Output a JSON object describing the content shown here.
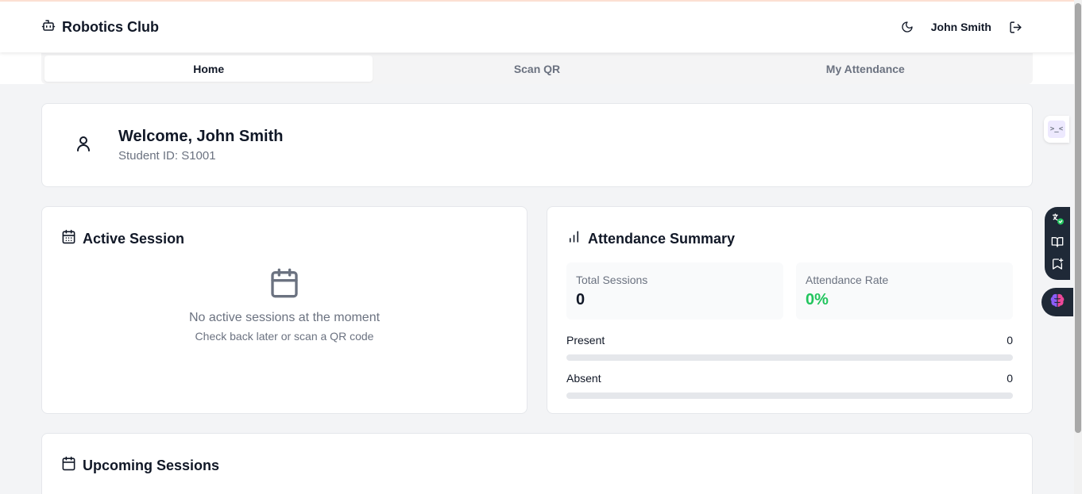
{
  "app": {
    "title": "Robotics Club"
  },
  "header": {
    "user_name": "John Smith",
    "icons": [
      "bot-icon",
      "moon-icon",
      "logout-icon"
    ]
  },
  "tabs": [
    {
      "label": "Home",
      "active": true
    },
    {
      "label": "Scan QR",
      "active": false
    },
    {
      "label": "My Attendance",
      "active": false
    }
  ],
  "welcome": {
    "title": "Welcome, John Smith",
    "student_id": "Student ID: S1001"
  },
  "active_session": {
    "title": "Active Session",
    "empty_title": "No active sessions at the moment",
    "empty_hint": "Check back later or scan a QR code"
  },
  "attendance_summary": {
    "title": "Attendance Summary",
    "total_sessions_label": "Total Sessions",
    "total_sessions": "0",
    "rate_label": "Attendance Rate",
    "rate": "0%",
    "present_label": "Present",
    "present": "0",
    "present_fraction": 0,
    "absent_label": "Absent",
    "absent": "0",
    "absent_fraction": 0
  },
  "upcoming": {
    "title": "Upcoming Sessions"
  },
  "colors": {
    "accent_green": "#22c55e",
    "background": "#f3f4f6",
    "card": "#ffffff",
    "muted_text": "#6b7280"
  },
  "extension_widgets": {
    "icons": [
      "code-icon",
      "translate-check-icon",
      "book-icon",
      "bookmark-add-icon",
      "brain-icon"
    ]
  }
}
